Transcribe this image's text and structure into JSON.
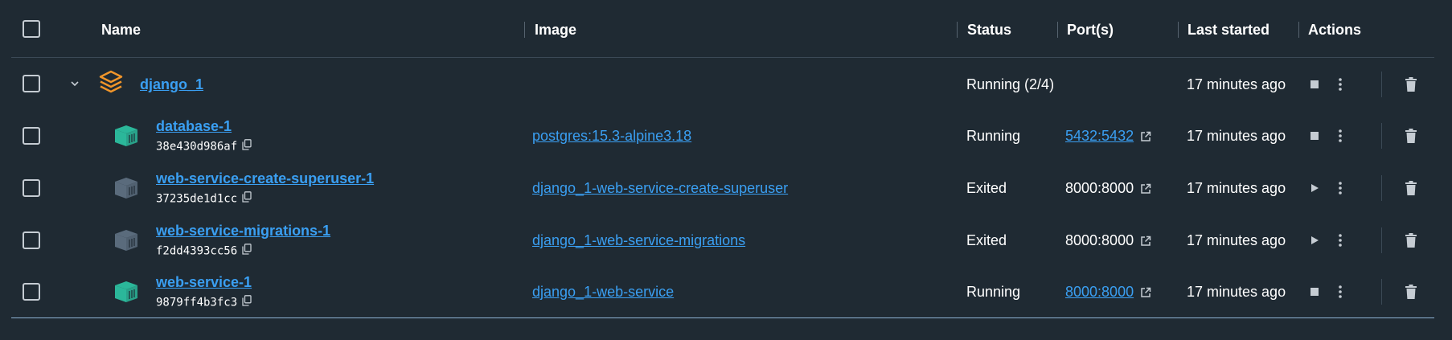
{
  "header": {
    "name": "Name",
    "image": "Image",
    "status": "Status",
    "ports": "Port(s)",
    "last_started": "Last started",
    "actions": "Actions"
  },
  "group": {
    "name": "django_1",
    "status": "Running (2/4)",
    "last_started": "17 minutes ago",
    "icon": "stack-icon",
    "icon_color": "#f0952a"
  },
  "containers": [
    {
      "name": "database-1",
      "id": "38e430d986af",
      "image": "postgres:15.3-alpine3.18",
      "status": "Running",
      "port": "5432:5432",
      "port_is_link": true,
      "last_started": "17 minutes ago",
      "running": true
    },
    {
      "name": "web-service-create-superuser-1",
      "id": "37235de1d1cc",
      "image": "django_1-web-service-create-superuser",
      "status": "Exited",
      "port": "8000:8000",
      "port_is_link": false,
      "last_started": "17 minutes ago",
      "running": false
    },
    {
      "name": "web-service-migrations-1",
      "id": "f2dd4393cc56",
      "image": "django_1-web-service-migrations",
      "status": "Exited",
      "port": "8000:8000",
      "port_is_link": false,
      "last_started": "17 minutes ago",
      "running": false
    },
    {
      "name": "web-service-1",
      "id": "9879ff4b3fc3",
      "image": "django_1-web-service",
      "status": "Running",
      "port": "8000:8000",
      "port_is_link": true,
      "last_started": "17 minutes ago",
      "running": true
    }
  ],
  "colors": {
    "background": "#1f2a33",
    "link": "#3a9ff2",
    "running_container": "#2bb79a",
    "exited_container": "#5a6b7c",
    "group_icon": "#f0952a"
  }
}
